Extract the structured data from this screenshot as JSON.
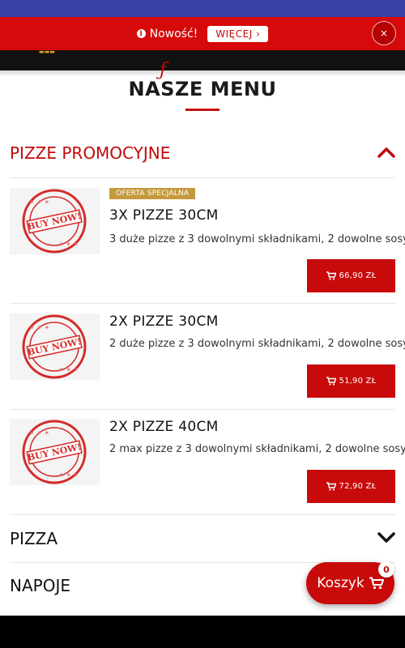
{
  "notice": {
    "text": "Nowość!",
    "more_label": "WIĘCEJ ›",
    "close_label": "×"
  },
  "menu": {
    "title": "NASZE MENU"
  },
  "categories": [
    {
      "label": "PIZZE PROMOCYJNE"
    },
    {
      "label": "PIZZA"
    },
    {
      "label": "NAPOJE"
    }
  ],
  "items": [
    {
      "badge": "OFERTA SPECJALNA",
      "name": "3X PIZZE 30CM",
      "desc": "3 duże pizze z 3 dowolnymi składnikami, 2 dowolne sosy",
      "price": "66,90 ZŁ",
      "thumb_text": "BUY NOW!"
    },
    {
      "name": "2X PIZZE 30CM",
      "desc": "2 duże pizze z 3 dowolnymi składnikami, 2 dowolne sosy",
      "price": "51,90 ZŁ",
      "thumb_text": "BUY NOW!"
    },
    {
      "name": "2X PIZZE 40CM",
      "desc": "2 max pizze z 3 dowolnymi składnikami, 2 dowolne sosy",
      "price": "72,90 ZŁ",
      "thumb_text": "BUY NOW!"
    }
  ],
  "cart": {
    "label": "Koszyk",
    "count": "0"
  },
  "colors": {
    "brand_red": "#c90a0a",
    "badge_gold": "#c59a3c",
    "topbar_blue": "#3b3fa8"
  }
}
